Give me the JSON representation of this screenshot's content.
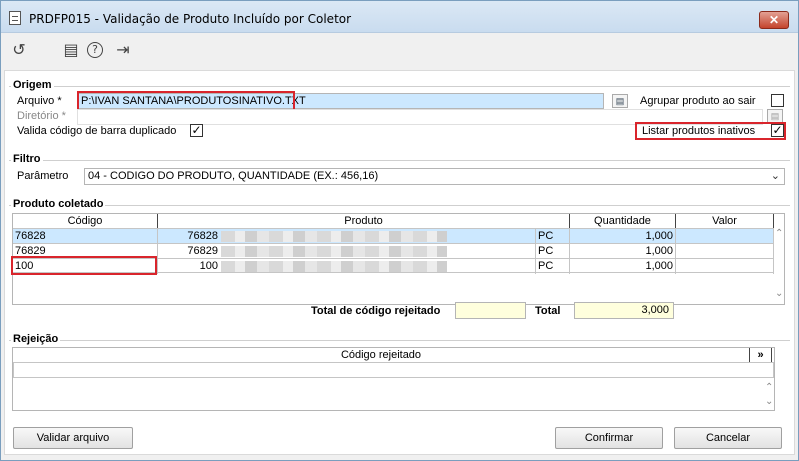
{
  "window": {
    "title": "PRDFP015 - Validação de Produto Incluído por Coletor",
    "close": "✕"
  },
  "toolbar": {
    "refresh_icon": "↺",
    "calendar_icon": "▤",
    "help_icon": "?",
    "exit_icon": "⇥"
  },
  "origem": {
    "label": "Origem",
    "arquivo_label": "Arquivo *",
    "arquivo_value": "P:\\IVAN SANTANA\\PRODUTOSINATIVO.TXT",
    "diretorio_label": "Diretório *",
    "diretorio_value": "",
    "agrupar_label": "Agrupar produto ao sair",
    "agrupar_checked": "",
    "valida_label": "Valida código de barra duplicado",
    "valida_checked": "✓",
    "listar_label": "Listar produtos inativos",
    "listar_checked": "✓",
    "browse_icon": "▤"
  },
  "filtro": {
    "label": "Filtro",
    "parametro_label": "Parâmetro",
    "parametro_value": "04 - CODIGO DO PRODUTO, QUANTIDADE (EX.: 456,16)",
    "arrow": "⌄"
  },
  "produto": {
    "label": "Produto coletado",
    "headers": {
      "codigo": "Código",
      "produto": "Produto",
      "quantidade": "Quantidade",
      "valor": "Valor"
    },
    "rows": [
      {
        "codigo": "76828",
        "prod_code": "76828",
        "unid": "PC",
        "quantidade": "1,000",
        "valor": ""
      },
      {
        "codigo": "76829",
        "prod_code": "76829",
        "unid": "PC",
        "quantidade": "1,000",
        "valor": ""
      },
      {
        "codigo": "100",
        "prod_code": "100",
        "unid": "PC",
        "quantidade": "1,000",
        "valor": ""
      }
    ],
    "scroll_up": "⌃",
    "scroll_down": "⌄",
    "total_rejeitado_label": "Total de código rejeitado",
    "total_rejeitado_value": "",
    "total_label": "Total",
    "total_value": "3,000"
  },
  "rejeicao": {
    "label": "Rejeição",
    "header": "Código rejeitado",
    "expand": "»",
    "scroll_up": "⌃",
    "scroll_down": "⌄"
  },
  "buttons": {
    "validar": "Validar arquivo",
    "confirmar": "Confirmar",
    "cancelar": "Cancelar"
  }
}
